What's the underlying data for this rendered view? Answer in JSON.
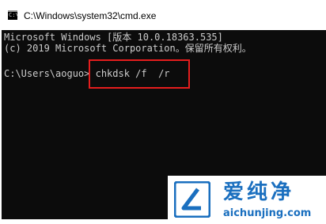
{
  "window": {
    "title": "C:\\Windows\\system32\\cmd.exe",
    "icon": "cmd-icon"
  },
  "console": {
    "line1": "Microsoft Windows [版本 10.0.18363.535]",
    "line2": "(c) 2019 Microsoft Corporation。保留所有权利。",
    "prompt": "C:\\Users\\aoguo>",
    "command": "chkdsk /f  /r",
    "background": "#0c0c0c",
    "text_color": "#cccccc",
    "highlight_color": "#e51d1d"
  },
  "watermark": {
    "text": "爱纯净",
    "url": "aichunjing.com",
    "logo": "watermark-logo",
    "color": "#1a6fbf"
  }
}
